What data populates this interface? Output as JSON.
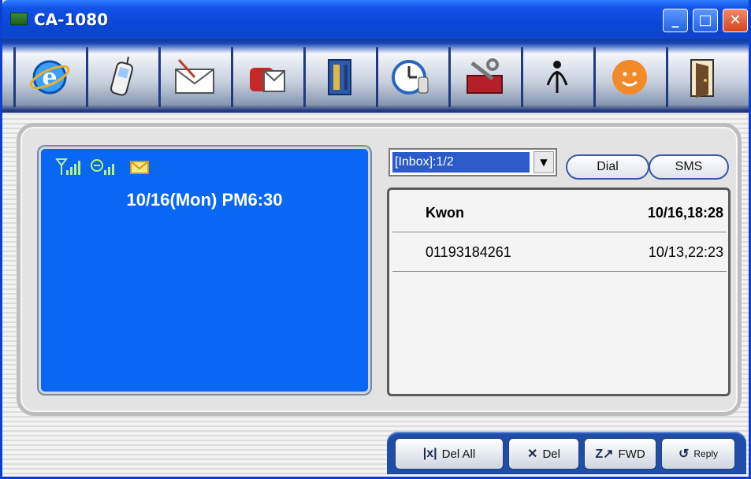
{
  "window": {
    "title": "CA-1080",
    "controls": {
      "minimize": "_",
      "maximize": "□",
      "close": "✕"
    }
  },
  "toolbar": {
    "items": [
      {
        "name": "internet-icon"
      },
      {
        "name": "phone-icon"
      },
      {
        "name": "mail-compose-icon"
      },
      {
        "name": "mailbox-icon"
      },
      {
        "name": "phonebook-icon"
      },
      {
        "name": "clock-icon"
      },
      {
        "name": "toolbox-icon"
      },
      {
        "name": "person-icon"
      },
      {
        "name": "smiley-icon"
      },
      {
        "name": "exit-door-icon"
      }
    ]
  },
  "phone_screen": {
    "status_icons": [
      "signal-icon",
      "battery-icon",
      "message-icon"
    ],
    "datetime": "10/16(Mon) PM6:30"
  },
  "mailbox": {
    "selected": "[Inbox]:1/2"
  },
  "buttons": {
    "dial": "Dial",
    "sms": "SMS"
  },
  "messages": [
    {
      "sender": "Kwon",
      "time": "10/16,18:28",
      "unread": true
    },
    {
      "sender": "01193184261",
      "time": "10/13,22:23",
      "unread": false
    }
  ],
  "actions": {
    "del_all": {
      "label": "Del All",
      "icon": "|x|"
    },
    "del": {
      "label": "Del",
      "icon": "✕"
    },
    "fwd": {
      "label": "FWD",
      "icon": "Z↗"
    },
    "reply": {
      "label": "Reply",
      "icon": "↺"
    }
  },
  "colors": {
    "titlebar": "#0a47d8",
    "screen": "#0a67f5",
    "selection": "#2a5bc9"
  }
}
